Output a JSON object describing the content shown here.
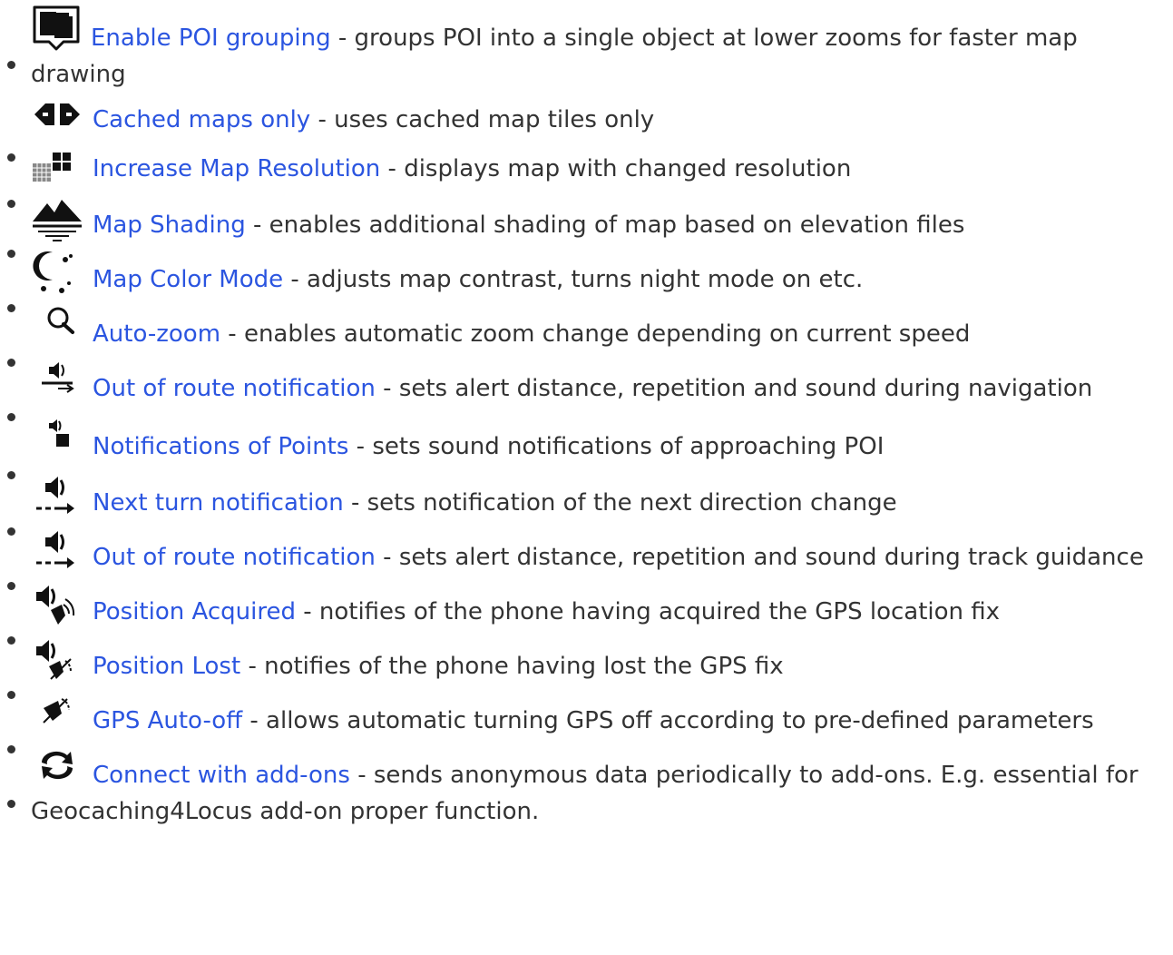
{
  "colors": {
    "link": "#2b55e0",
    "text": "#333333",
    "icon": "#111111"
  },
  "items": [
    {
      "icon": "poi-grouping-icon",
      "link": "Enable POI grouping",
      "desc": " - groups POI into a single object at lower zooms for faster map drawing"
    },
    {
      "icon": "cached-maps-icon",
      "link": "Cached maps only",
      "desc": " - uses cached map tiles only"
    },
    {
      "icon": "map-resolution-icon",
      "link": "Increase Map Resolution",
      "desc": " - displays map with changed resolution"
    },
    {
      "icon": "map-shading-icon",
      "link": "Map Shading",
      "desc": " - enables additional shading of map based on elevation files"
    },
    {
      "icon": "color-mode-icon",
      "link": "Map Color Mode",
      "desc": " - adjusts map contrast, turns night mode on etc."
    },
    {
      "icon": "auto-zoom-icon",
      "link": "Auto-zoom",
      "desc": " - enables automatic zoom change depending on current speed"
    },
    {
      "icon": "route-notification-icon",
      "link": "Out of route notification",
      "desc": " - sets alert distance, repetition and sound during navigation"
    },
    {
      "icon": "points-notification-icon",
      "link": "Notifications of Points",
      "desc": " - sets sound notifications of approaching POI"
    },
    {
      "icon": "next-turn-icon",
      "link": "Next turn notification",
      "desc": " - sets notification of the next direction change"
    },
    {
      "icon": "track-notification-icon",
      "link": "Out of route notification",
      "desc": " - sets alert distance, repetition and sound during track guidance"
    },
    {
      "icon": "position-acquired-icon",
      "link": "Position Acquired",
      "desc": " - notifies of the phone having acquired the GPS location fix"
    },
    {
      "icon": "position-lost-icon",
      "link": "Position Lost",
      "desc": " - notifies of the phone having lost the GPS fix"
    },
    {
      "icon": "gps-auto-off-icon",
      "link": "GPS Auto-off",
      "desc": " - allows automatic turning GPS off according to pre-defined parameters"
    },
    {
      "icon": "connect-addons-icon",
      "link": "Connect with add-ons",
      "desc": " - sends anonymous data periodically to add-ons. E.g. essential for Geocaching4Locus add-on proper function."
    }
  ]
}
